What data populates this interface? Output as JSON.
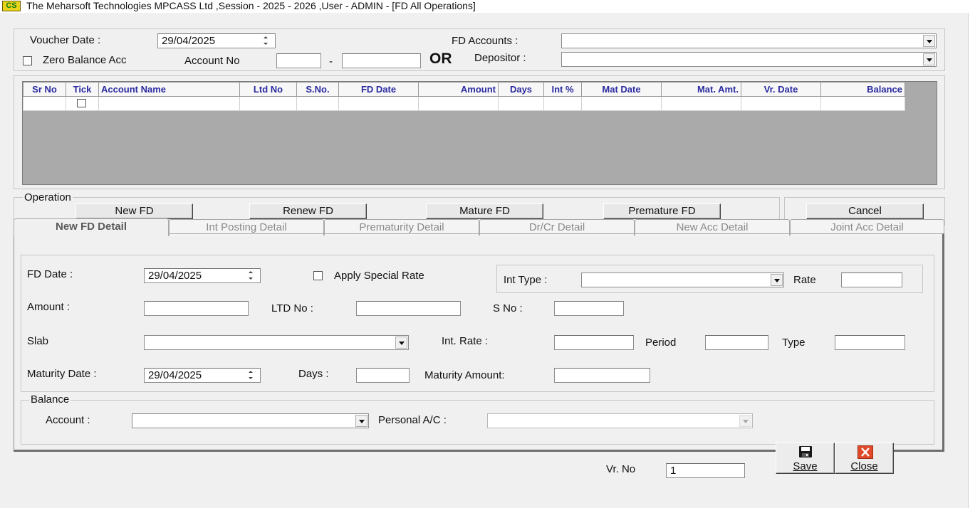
{
  "window": {
    "app_icon": "CS",
    "title": "The Meharsoft Technologies MPCASS Ltd ,Session - 2025 - 2026 ,User - ADMIN - [FD All Operations]"
  },
  "header": {
    "voucher_date_label": "Voucher Date :",
    "voucher_date_value": "29/04/2025",
    "fd_accounts_label": "FD Accounts :",
    "zero_balance_label": "Zero Balance Acc",
    "account_no_label": "Account No",
    "dash": "-",
    "or_label": "OR",
    "depositor_label": "Depositor :"
  },
  "grid": {
    "columns": [
      "Sr No",
      "Tick",
      "Account Name",
      "Ltd No",
      "S.No.",
      "FD Date",
      "Amount",
      "Days",
      "Int %",
      "Mat Date",
      "Mat. Amt.",
      "Vr. Date",
      "Balance"
    ]
  },
  "operation": {
    "legend": "Operation",
    "new_fd": "New FD",
    "renew_fd": "Renew FD",
    "mature_fd": "Mature FD",
    "premature_fd": "Premature FD",
    "cancel": "Cancel"
  },
  "tabs": [
    {
      "label": "New FD Detail",
      "active": true
    },
    {
      "label": "Int Posting Detail",
      "active": false
    },
    {
      "label": "Prematurity Detail",
      "active": false
    },
    {
      "label": "Dr/Cr Detail",
      "active": false
    },
    {
      "label": "New Acc Detail",
      "active": false
    },
    {
      "label": "Joint Acc Detail",
      "active": false
    }
  ],
  "detail": {
    "fd_date_label": "FD Date :",
    "fd_date_value": "29/04/2025",
    "apply_special_rate_label": "Apply Special Rate",
    "int_type_label": "Int Type :",
    "rate_label": "Rate",
    "amount_label": "Amount :",
    "ltd_no_label": "LTD No :",
    "s_no_label": "S No :",
    "slab_label": "Slab",
    "int_rate_label": "Int. Rate :",
    "period_label": "Period",
    "type_label": "Type",
    "maturity_date_label": "Maturity Date :",
    "maturity_date_value": "29/04/2025",
    "days_label": "Days :",
    "maturity_amount_label": "Maturity Amount:"
  },
  "balance": {
    "legend": "Balance",
    "account_label": "Account :",
    "personal_ac_label": "Personal A/C :"
  },
  "footer": {
    "vr_no_label": "Vr. No",
    "vr_no_value": "1",
    "save_label": "Save",
    "close_label": "Close",
    "save_icon": "floppy-disk-icon",
    "close_icon": "red-x-icon"
  }
}
